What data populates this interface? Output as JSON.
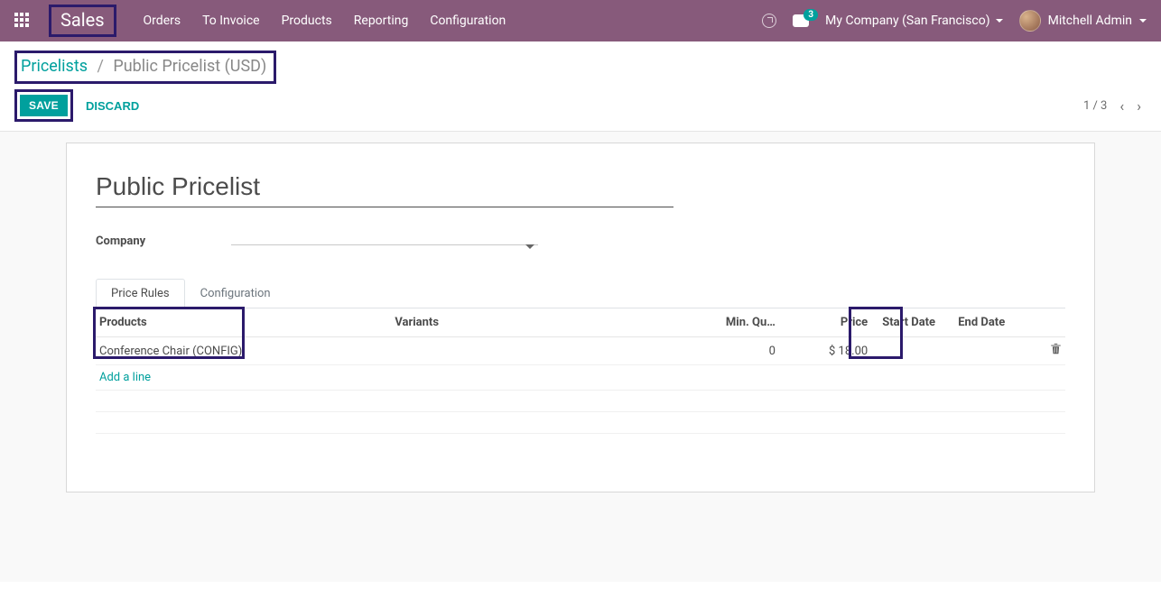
{
  "nav": {
    "brand": "Sales",
    "items": [
      "Orders",
      "To Invoice",
      "Products",
      "Reporting",
      "Configuration"
    ],
    "chat_badge": "3",
    "company": "My Company (San Francisco)",
    "user": "Mitchell Admin"
  },
  "breadcrumb": {
    "root": "Pricelists",
    "current": "Public Pricelist (USD)"
  },
  "actions": {
    "save": "SAVE",
    "discard": "DISCARD"
  },
  "pager": {
    "text": "1 / 3"
  },
  "form": {
    "title": "Public Pricelist",
    "company_label": "Company",
    "company_value": ""
  },
  "tabs": {
    "price_rules": "Price Rules",
    "configuration": "Configuration"
  },
  "table": {
    "headers": {
      "products": "Products",
      "variants": "Variants",
      "min_qty": "Min. Qu…",
      "price": "Price",
      "start_date": "Start Date",
      "end_date": "End Date"
    },
    "rows": [
      {
        "product": "Conference Chair (CONFIG)",
        "variants": "",
        "min_qty": "0",
        "price": "$ 18.00",
        "start_date": "",
        "end_date": ""
      }
    ],
    "add_line": "Add a line"
  }
}
